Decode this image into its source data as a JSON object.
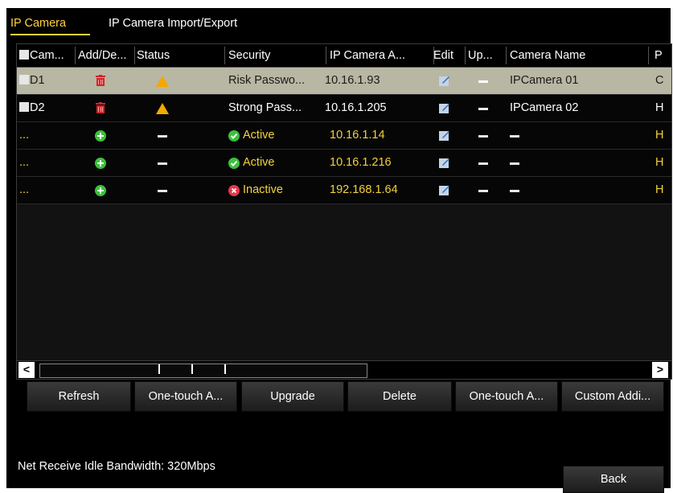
{
  "tabs": [
    {
      "label": "IP Camera",
      "active": true
    },
    {
      "label": "IP Camera Import/Export",
      "active": false
    }
  ],
  "table": {
    "headers": [
      "Cam...",
      "Add/De...",
      "Status",
      "Security",
      "IP Camera A...",
      "Edit",
      "Up...",
      "Camera Name",
      "P"
    ],
    "rows": [
      {
        "camera": "D1",
        "add_delete_icon": "trash-icon",
        "status_icon": "warning-icon",
        "security": "Risk Passwo...",
        "security_icon": "",
        "ip": "10.16.1.93",
        "camera_name": "IPCamera 01",
        "protocol": "C",
        "selected": true
      },
      {
        "camera": "D2",
        "add_delete_icon": "trash-icon",
        "status_icon": "warning-icon",
        "security": "Strong Pass...",
        "security_icon": "",
        "ip": "10.16.1.205",
        "camera_name": "IPCamera 02",
        "protocol": "H",
        "selected": false
      },
      {
        "camera": "...",
        "add_delete_icon": "add-icon",
        "status_icon": "",
        "security": "Active",
        "security_icon": "check-icon",
        "ip": "10.16.1.14",
        "camera_name": "",
        "protocol": "H",
        "selected": false
      },
      {
        "camera": "...",
        "add_delete_icon": "add-icon",
        "status_icon": "",
        "security": "Active",
        "security_icon": "check-icon",
        "ip": "10.16.1.216",
        "camera_name": "",
        "protocol": "H",
        "selected": false
      },
      {
        "camera": "...",
        "add_delete_icon": "add-icon",
        "status_icon": "",
        "security": "Inactive",
        "security_icon": "cross-icon",
        "ip": "192.168.1.64",
        "camera_name": "",
        "protocol": "H",
        "selected": false
      }
    ]
  },
  "scrollbar": {
    "left_arrow": "<",
    "right_arrow": ">"
  },
  "buttons": {
    "refresh": "Refresh",
    "one_touch_1": "One-touch A...",
    "upgrade": "Upgrade",
    "delete": "Delete",
    "one_touch_2": "One-touch A...",
    "custom_add": "Custom Addi..."
  },
  "footer": {
    "bandwidth": "Net Receive Idle Bandwidth: 320Mbps",
    "back": "Back"
  },
  "colors": {
    "accent_yellow": "#ffd23c",
    "selected_row": "#b8b7a3",
    "active_green": "#3cc03c",
    "inactive_red": "#e0394a",
    "trash_red": "#d2232a"
  }
}
